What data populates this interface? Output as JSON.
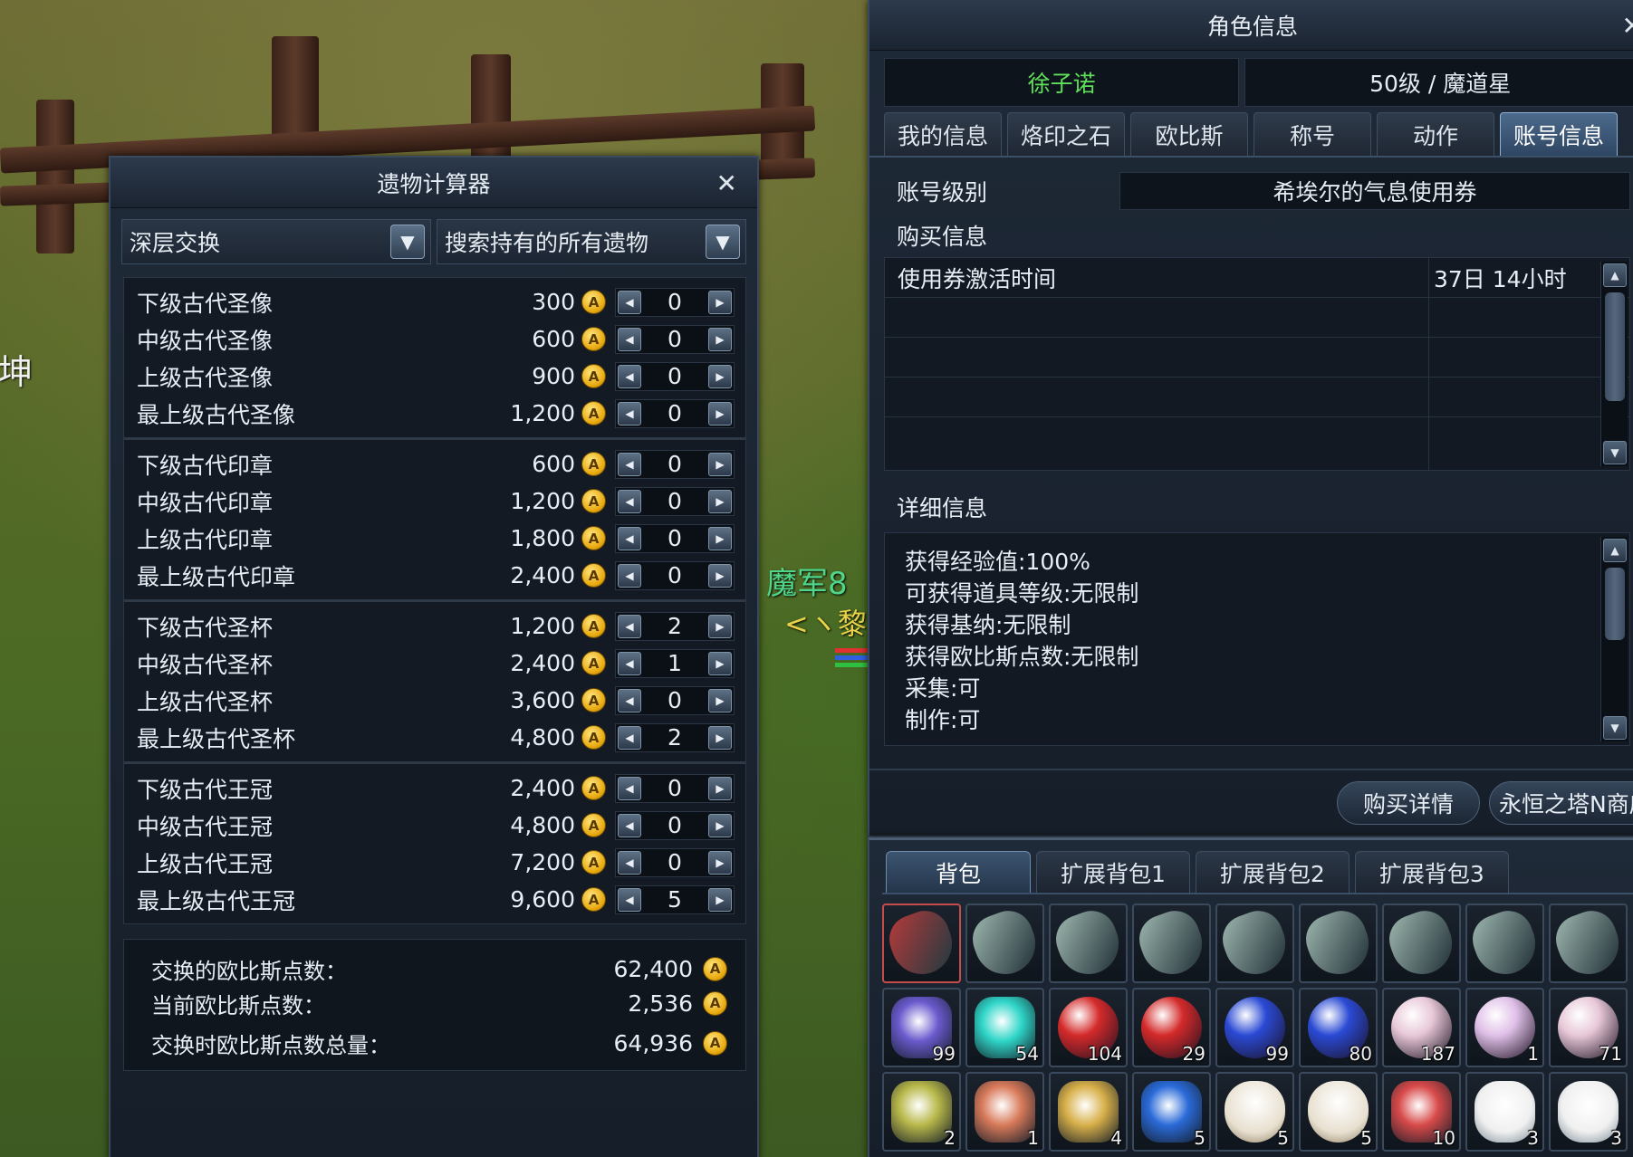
{
  "background": {
    "partial_text": "坤",
    "npc_name": "魔军8",
    "npc_subtitle": "<ヽ黎"
  },
  "relic_calculator": {
    "title": "遗物计算器",
    "exchange_dropdown": "深层交换",
    "search_dropdown": "搜索持有的所有遗物",
    "currency_icon_letter": "A",
    "groups": [
      {
        "items": [
          {
            "name": "下级古代圣像",
            "price": "300",
            "qty": "0"
          },
          {
            "name": "中级古代圣像",
            "price": "600",
            "qty": "0"
          },
          {
            "name": "上级古代圣像",
            "price": "900",
            "qty": "0"
          },
          {
            "name": "最上级古代圣像",
            "price": "1,200",
            "qty": "0"
          }
        ]
      },
      {
        "items": [
          {
            "name": "下级古代印章",
            "price": "600",
            "qty": "0"
          },
          {
            "name": "中级古代印章",
            "price": "1,200",
            "qty": "0"
          },
          {
            "name": "上级古代印章",
            "price": "1,800",
            "qty": "0"
          },
          {
            "name": "最上级古代印章",
            "price": "2,400",
            "qty": "0"
          }
        ]
      },
      {
        "items": [
          {
            "name": "下级古代圣杯",
            "price": "1,200",
            "qty": "2"
          },
          {
            "name": "中级古代圣杯",
            "price": "2,400",
            "qty": "1"
          },
          {
            "name": "上级古代圣杯",
            "price": "3,600",
            "qty": "0"
          },
          {
            "name": "最上级古代圣杯",
            "price": "4,800",
            "qty": "2"
          }
        ]
      },
      {
        "items": [
          {
            "name": "下级古代王冠",
            "price": "2,400",
            "qty": "0"
          },
          {
            "name": "中级古代王冠",
            "price": "4,800",
            "qty": "0"
          },
          {
            "name": "上级古代王冠",
            "price": "7,200",
            "qty": "0"
          },
          {
            "name": "最上级古代王冠",
            "price": "9,600",
            "qty": "5"
          }
        ]
      }
    ],
    "summary": {
      "exchanged_label": "交换的欧比斯点数：",
      "exchanged_value": "62,400",
      "current_label": "当前欧比斯点数：",
      "current_value": "2,536",
      "total_label": "交换时欧比斯点数总量：",
      "total_value": "64,936"
    }
  },
  "character_info": {
    "title": "角色信息",
    "name": "徐子诺",
    "name_color": "#5fe05a",
    "level_class": "50级 / 魔道星",
    "tabs": [
      "我的信息",
      "烙印之石",
      "欧比斯",
      "称号",
      "动作",
      "账号信息"
    ],
    "active_tab": "账号信息",
    "account_level_label": "账号级别",
    "account_level_value": "希埃尔的气息使用券",
    "purchase_label": "购买信息",
    "purchase_table": [
      {
        "name": "使用券激活时间",
        "value": "37日 14小时"
      }
    ],
    "detail_label": "详细信息",
    "details": [
      "获得经验值:100%",
      "可获得道具等级:无限制",
      "获得基纳:无限制",
      "获得欧比斯点数:无限制",
      "采集:可",
      "制作:可"
    ],
    "buttons": {
      "purchase_details": "购买详情",
      "shop": "永恒之塔N商店"
    }
  },
  "inventory": {
    "tabs": [
      "背包",
      "扩展背包1",
      "扩展背包2",
      "扩展背包3"
    ],
    "active_tab": "背包",
    "rows": [
      [
        {
          "icon": "red-stigma-stone-icon",
          "qty": "",
          "color": "#b83a3a"
        },
        {
          "icon": "stigma-stone-icon",
          "qty": "",
          "color": "#9fb8b0"
        },
        {
          "icon": "stigma-stone-icon",
          "qty": "",
          "color": "#9fb8b0"
        },
        {
          "icon": "stigma-stone-icon",
          "qty": "",
          "color": "#9fb8b0"
        },
        {
          "icon": "stigma-stone-icon",
          "qty": "",
          "color": "#9fb8b0"
        },
        {
          "icon": "stigma-stone-icon",
          "qty": "",
          "color": "#9fb8b0"
        },
        {
          "icon": "stigma-stone-icon",
          "qty": "",
          "color": "#9fb8b0"
        },
        {
          "icon": "stigma-stone-icon",
          "qty": "",
          "color": "#9fb8b0"
        },
        {
          "icon": "stigma-stone-icon",
          "qty": "",
          "color": "#9fb8b0"
        }
      ],
      [
        {
          "icon": "crystal-shard-icon",
          "qty": "99",
          "color": "#6a5acd"
        },
        {
          "icon": "cyan-flame-icon",
          "qty": "54",
          "color": "#2fd6c8"
        },
        {
          "icon": "red-orb-icon",
          "qty": "104",
          "color": "#d42a2a"
        },
        {
          "icon": "red-orb-icon",
          "qty": "29",
          "color": "#d42a2a"
        },
        {
          "icon": "blue-orb-icon",
          "qty": "99",
          "color": "#2a4ad4"
        },
        {
          "icon": "blue-orb-icon",
          "qty": "80",
          "color": "#2a4ad4"
        },
        {
          "icon": "pink-orb-icon",
          "qty": "187",
          "color": "#e8c8d8"
        },
        {
          "icon": "pink-orb-icon",
          "qty": "1",
          "color": "#e0c0e8"
        },
        {
          "icon": "pink-orb-icon",
          "qty": "71",
          "color": "#e8c8d8"
        }
      ],
      [
        {
          "icon": "herb-icon",
          "qty": "2",
          "color": "#b8b84a"
        },
        {
          "icon": "sushi-icon",
          "qty": "1",
          "color": "#d87a5a"
        },
        {
          "icon": "golden-flask-icon",
          "qty": "4",
          "color": "#d8b04a"
        },
        {
          "icon": "blue-spirit-icon",
          "qty": "5",
          "color": "#2a6ad8"
        },
        {
          "icon": "rice-bowl-icon",
          "qty": "5",
          "color": "#e8e0d0"
        },
        {
          "icon": "rice-bowl-icon",
          "qty": "5",
          "color": "#e8e0d0"
        },
        {
          "icon": "shell-icon",
          "qty": "10",
          "color": "#d84a4a"
        },
        {
          "icon": "polar-bear-icon",
          "qty": "3",
          "color": "#f0f0f0"
        },
        {
          "icon": "polar-bear-icon",
          "qty": "3",
          "color": "#f0f0f0"
        }
      ]
    ]
  }
}
